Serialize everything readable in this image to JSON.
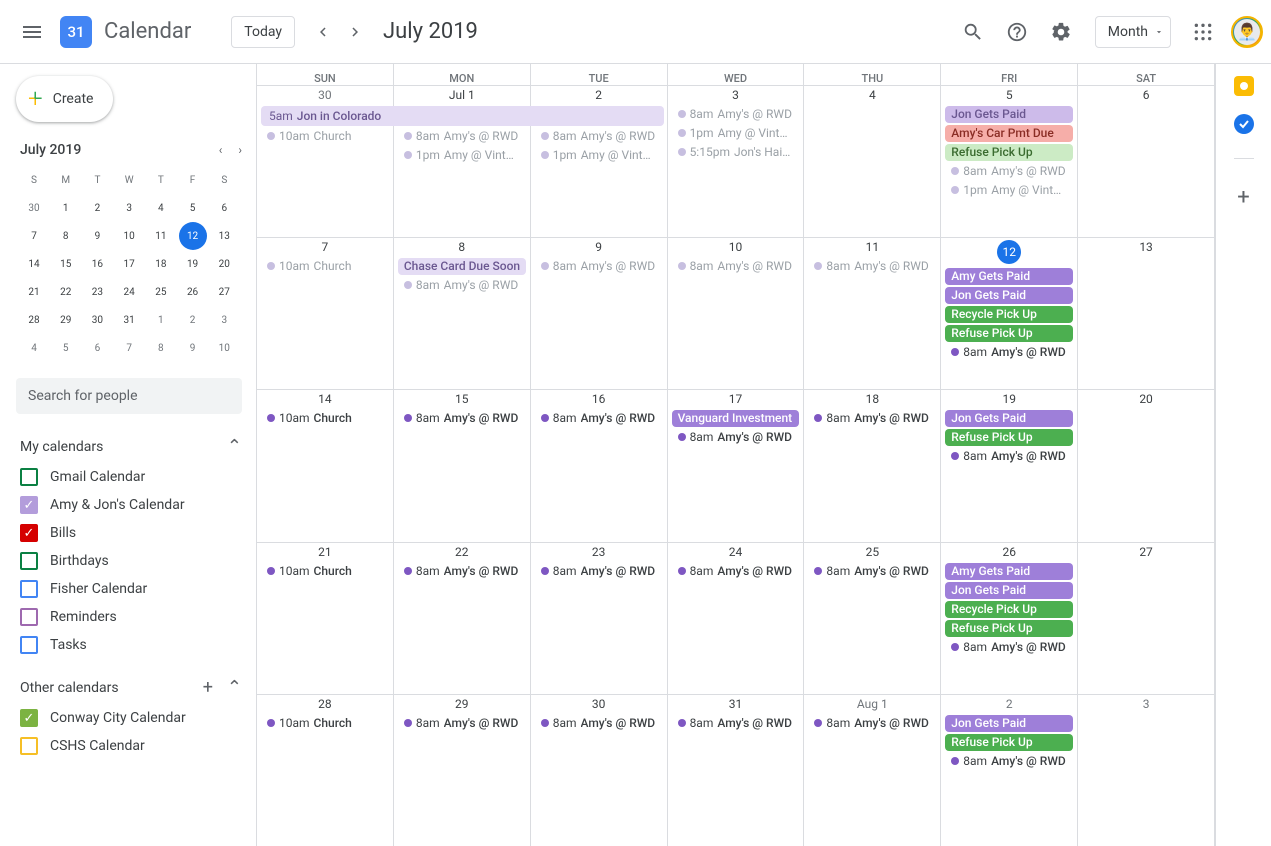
{
  "header": {
    "app_title": "Calendar",
    "logo_day": "31",
    "today": "Today",
    "title": "July 2019",
    "view": "Month"
  },
  "create": "Create",
  "mini": {
    "title": "July 2019",
    "dow": [
      "S",
      "M",
      "T",
      "W",
      "T",
      "F",
      "S"
    ],
    "cells": [
      {
        "n": "30",
        "o": true
      },
      {
        "n": "1"
      },
      {
        "n": "2"
      },
      {
        "n": "3"
      },
      {
        "n": "4"
      },
      {
        "n": "5"
      },
      {
        "n": "6"
      },
      {
        "n": "7"
      },
      {
        "n": "8"
      },
      {
        "n": "9"
      },
      {
        "n": "10"
      },
      {
        "n": "11"
      },
      {
        "n": "12",
        "today": true
      },
      {
        "n": "13"
      },
      {
        "n": "14"
      },
      {
        "n": "15"
      },
      {
        "n": "16"
      },
      {
        "n": "17"
      },
      {
        "n": "18"
      },
      {
        "n": "19"
      },
      {
        "n": "20"
      },
      {
        "n": "21"
      },
      {
        "n": "22"
      },
      {
        "n": "23"
      },
      {
        "n": "24"
      },
      {
        "n": "25"
      },
      {
        "n": "26"
      },
      {
        "n": "27"
      },
      {
        "n": "28"
      },
      {
        "n": "29"
      },
      {
        "n": "30"
      },
      {
        "n": "31"
      },
      {
        "n": "1",
        "o": true
      },
      {
        "n": "2",
        "o": true
      },
      {
        "n": "3",
        "o": true
      },
      {
        "n": "4",
        "o": true
      },
      {
        "n": "5",
        "o": true
      },
      {
        "n": "6",
        "o": true
      },
      {
        "n": "7",
        "o": true
      },
      {
        "n": "8",
        "o": true
      },
      {
        "n": "9",
        "o": true
      },
      {
        "n": "10",
        "o": true
      }
    ]
  },
  "search_people": "Search for people",
  "my_calendars": {
    "title": "My calendars",
    "items": [
      {
        "label": "Gmail Calendar",
        "color": "#0b8043",
        "checked": false
      },
      {
        "label": "Amy & Jon's Calendar",
        "color": "#b39ddb",
        "checked": true
      },
      {
        "label": "Bills",
        "color": "#d50000",
        "checked": true
      },
      {
        "label": "Birthdays",
        "color": "#0b8043",
        "checked": false
      },
      {
        "label": "Fisher Calendar",
        "color": "#4285f4",
        "checked": false
      },
      {
        "label": "Reminders",
        "color": "#9e69af",
        "checked": false
      },
      {
        "label": "Tasks",
        "color": "#4285f4",
        "checked": false
      }
    ]
  },
  "other_calendars": {
    "title": "Other calendars",
    "items": [
      {
        "label": "Conway City Calendar",
        "color": "#7cb342",
        "checked": true
      },
      {
        "label": "CSHS Calendar",
        "color": "#f6bf26",
        "checked": false
      }
    ]
  },
  "grid": {
    "dow": [
      "SUN",
      "MON",
      "TUE",
      "WED",
      "THU",
      "FRI",
      "SAT"
    ],
    "span_event": {
      "time": "5am",
      "title": "Jon in Colorado",
      "days": 3
    },
    "weeks": [
      [
        {
          "n": "30",
          "o": true,
          "events": [
            {
              "t": "dot",
              "past": true,
              "color": "#b39ddb",
              "time": "10am",
              "title": "Church"
            }
          ],
          "spanpad": true
        },
        {
          "n": "Jul 1",
          "events": [
            {
              "t": "dot",
              "past": true,
              "color": "#b39ddb",
              "time": "8am",
              "title": "Amy's @ RWD"
            },
            {
              "t": "dot",
              "past": true,
              "color": "#b39ddb",
              "time": "1pm",
              "title": "Amy @ Vintage"
            }
          ],
          "spanpad": true
        },
        {
          "n": "2",
          "events": [
            {
              "t": "dot",
              "past": true,
              "color": "#b39ddb",
              "time": "8am",
              "title": "Amy's @ RWD"
            },
            {
              "t": "dot",
              "past": true,
              "color": "#b39ddb",
              "time": "1pm",
              "title": "Amy @ Vintage"
            }
          ],
          "spanpad": true
        },
        {
          "n": "3",
          "events": [
            {
              "t": "dot",
              "past": true,
              "color": "#b39ddb",
              "time": "8am",
              "title": "Amy's @ RWD"
            },
            {
              "t": "dot",
              "past": true,
              "color": "#b39ddb",
              "time": "1pm",
              "title": "Amy @ Vintage"
            },
            {
              "t": "dot",
              "past": true,
              "color": "#b39ddb",
              "time": "5:15pm",
              "title": "Jon's Haircut"
            }
          ]
        },
        {
          "n": "4",
          "events": []
        },
        {
          "n": "5",
          "events": [
            {
              "t": "chip",
              "bg": "#cdbbea",
              "fg": "#6a5790",
              "title": "Jon Gets Paid"
            },
            {
              "t": "chip",
              "bg": "#f6aea9",
              "fg": "#8a2d25",
              "title": "Amy's Car Pmt Due"
            },
            {
              "t": "chip",
              "bg": "#ccebc5",
              "fg": "#3a6b2f",
              "title": "Refuse Pick Up"
            },
            {
              "t": "dot",
              "past": true,
              "color": "#b39ddb",
              "time": "8am",
              "title": "Amy's @ RWD"
            },
            {
              "t": "dot",
              "past": true,
              "color": "#b39ddb",
              "time": "1pm",
              "title": "Amy @ Vintage"
            }
          ]
        },
        {
          "n": "6",
          "events": []
        }
      ],
      [
        {
          "n": "7",
          "events": [
            {
              "t": "dot",
              "past": true,
              "color": "#b39ddb",
              "time": "10am",
              "title": "Church"
            }
          ]
        },
        {
          "n": "8",
          "events": [
            {
              "t": "chip",
              "bg": "#e4dcf4",
              "fg": "#6a5790",
              "title": "Chase Card Due Soon"
            },
            {
              "t": "dot",
              "past": true,
              "color": "#b39ddb",
              "time": "8am",
              "title": "Amy's @ RWD"
            }
          ]
        },
        {
          "n": "9",
          "events": [
            {
              "t": "dot",
              "past": true,
              "color": "#b39ddb",
              "time": "8am",
              "title": "Amy's @ RWD"
            }
          ]
        },
        {
          "n": "10",
          "events": [
            {
              "t": "dot",
              "past": true,
              "color": "#b39ddb",
              "time": "8am",
              "title": "Amy's @ RWD"
            }
          ]
        },
        {
          "n": "11",
          "events": [
            {
              "t": "dot",
              "past": true,
              "color": "#b39ddb",
              "time": "8am",
              "title": "Amy's @ RWD"
            }
          ]
        },
        {
          "n": "12",
          "today": true,
          "events": [
            {
              "t": "chip",
              "bg": "#9e7fd9",
              "fg": "#fff",
              "title": "Amy Gets Paid"
            },
            {
              "t": "chip",
              "bg": "#9e7fd9",
              "fg": "#fff",
              "title": "Jon Gets Paid"
            },
            {
              "t": "chip",
              "bg": "#4caf50",
              "fg": "#fff",
              "title": "Recycle Pick Up"
            },
            {
              "t": "chip",
              "bg": "#4caf50",
              "fg": "#fff",
              "title": "Refuse Pick Up"
            },
            {
              "t": "dot",
              "color": "#7e57c2",
              "time": "8am",
              "title": "Amy's @ RWD"
            }
          ]
        },
        {
          "n": "13",
          "events": []
        }
      ],
      [
        {
          "n": "14",
          "events": [
            {
              "t": "dot",
              "color": "#7e57c2",
              "time": "10am",
              "title": "Church"
            }
          ]
        },
        {
          "n": "15",
          "events": [
            {
              "t": "dot",
              "color": "#7e57c2",
              "time": "8am",
              "title": "Amy's @ RWD"
            }
          ]
        },
        {
          "n": "16",
          "events": [
            {
              "t": "dot",
              "color": "#7e57c2",
              "time": "8am",
              "title": "Amy's @ RWD"
            }
          ]
        },
        {
          "n": "17",
          "events": [
            {
              "t": "chip",
              "bg": "#9e7fd9",
              "fg": "#fff",
              "title": "Vanguard Investment"
            },
            {
              "t": "dot",
              "color": "#7e57c2",
              "time": "8am",
              "title": "Amy's @ RWD"
            }
          ]
        },
        {
          "n": "18",
          "events": [
            {
              "t": "dot",
              "color": "#7e57c2",
              "time": "8am",
              "title": "Amy's @ RWD"
            }
          ]
        },
        {
          "n": "19",
          "events": [
            {
              "t": "chip",
              "bg": "#9e7fd9",
              "fg": "#fff",
              "title": "Jon Gets Paid"
            },
            {
              "t": "chip",
              "bg": "#4caf50",
              "fg": "#fff",
              "title": "Refuse Pick Up"
            },
            {
              "t": "dot",
              "color": "#7e57c2",
              "time": "8am",
              "title": "Amy's @ RWD"
            }
          ]
        },
        {
          "n": "20",
          "events": []
        }
      ],
      [
        {
          "n": "21",
          "events": [
            {
              "t": "dot",
              "color": "#7e57c2",
              "time": "10am",
              "title": "Church"
            }
          ]
        },
        {
          "n": "22",
          "events": [
            {
              "t": "dot",
              "color": "#7e57c2",
              "time": "8am",
              "title": "Amy's @ RWD"
            }
          ]
        },
        {
          "n": "23",
          "events": [
            {
              "t": "dot",
              "color": "#7e57c2",
              "time": "8am",
              "title": "Amy's @ RWD"
            }
          ]
        },
        {
          "n": "24",
          "events": [
            {
              "t": "dot",
              "color": "#7e57c2",
              "time": "8am",
              "title": "Amy's @ RWD"
            }
          ]
        },
        {
          "n": "25",
          "events": [
            {
              "t": "dot",
              "color": "#7e57c2",
              "time": "8am",
              "title": "Amy's @ RWD"
            }
          ]
        },
        {
          "n": "26",
          "events": [
            {
              "t": "chip",
              "bg": "#9e7fd9",
              "fg": "#fff",
              "title": "Amy Gets Paid"
            },
            {
              "t": "chip",
              "bg": "#9e7fd9",
              "fg": "#fff",
              "title": "Jon Gets Paid"
            },
            {
              "t": "chip",
              "bg": "#4caf50",
              "fg": "#fff",
              "title": "Recycle Pick Up"
            },
            {
              "t": "chip",
              "bg": "#4caf50",
              "fg": "#fff",
              "title": "Refuse Pick Up"
            },
            {
              "t": "dot",
              "color": "#7e57c2",
              "time": "8am",
              "title": "Amy's @ RWD"
            }
          ]
        },
        {
          "n": "27",
          "events": []
        }
      ],
      [
        {
          "n": "28",
          "events": [
            {
              "t": "dot",
              "color": "#7e57c2",
              "time": "10am",
              "title": "Church"
            }
          ]
        },
        {
          "n": "29",
          "events": [
            {
              "t": "dot",
              "color": "#7e57c2",
              "time": "8am",
              "title": "Amy's @ RWD"
            }
          ]
        },
        {
          "n": "30",
          "events": [
            {
              "t": "dot",
              "color": "#7e57c2",
              "time": "8am",
              "title": "Amy's @ RWD"
            }
          ]
        },
        {
          "n": "31",
          "events": [
            {
              "t": "dot",
              "color": "#7e57c2",
              "time": "8am",
              "title": "Amy's @ RWD"
            }
          ]
        },
        {
          "n": "Aug 1",
          "o": true,
          "events": [
            {
              "t": "dot",
              "color": "#7e57c2",
              "time": "8am",
              "title": "Amy's @ RWD"
            }
          ]
        },
        {
          "n": "2",
          "o": true,
          "events": [
            {
              "t": "chip",
              "bg": "#9e7fd9",
              "fg": "#fff",
              "title": "Jon Gets Paid"
            },
            {
              "t": "chip",
              "bg": "#4caf50",
              "fg": "#fff",
              "title": "Refuse Pick Up"
            },
            {
              "t": "dot",
              "color": "#7e57c2",
              "time": "8am",
              "title": "Amy's @ RWD"
            }
          ]
        },
        {
          "n": "3",
          "o": true,
          "events": []
        }
      ],
      [
        {
          "n": "",
          "events": []
        },
        {
          "n": "",
          "events": []
        },
        {
          "n": "",
          "events": []
        },
        {
          "n": "",
          "events": []
        },
        {
          "n": "",
          "events": []
        },
        {
          "n": "",
          "events": []
        },
        {
          "n": "",
          "events": []
        }
      ]
    ]
  }
}
